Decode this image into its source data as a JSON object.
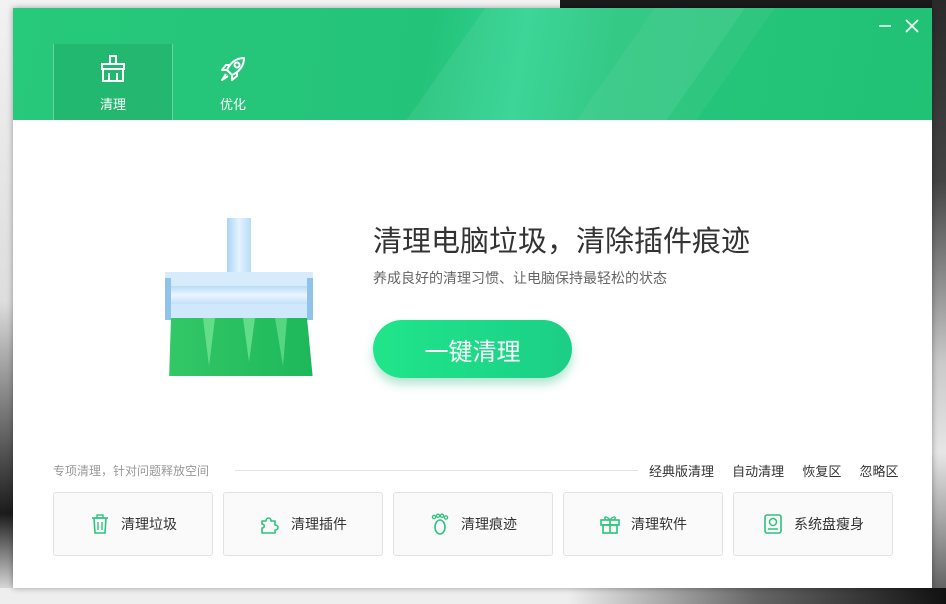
{
  "tabs": [
    {
      "label": "清理",
      "icon": "broom-icon",
      "active": true
    },
    {
      "label": "优化",
      "icon": "rocket-icon",
      "active": false
    }
  ],
  "window_controls": {
    "minimize": "minimize-icon",
    "close": "close-icon"
  },
  "hero": {
    "title": "清理电脑垃圾，清除插件痕迹",
    "subtitle": "养成良好的清理习惯、让电脑保持最轻松的状态",
    "button": "一键清理"
  },
  "section": {
    "label": "专项清理，针对问题释放空间",
    "links": [
      "经典版清理",
      "自动清理",
      "恢复区",
      "忽略区"
    ]
  },
  "cards": [
    {
      "label": "清理垃圾",
      "icon": "trash-icon"
    },
    {
      "label": "清理插件",
      "icon": "puzzle-icon"
    },
    {
      "label": "清理痕迹",
      "icon": "footprint-icon"
    },
    {
      "label": "清理软件",
      "icon": "gift-box-icon"
    },
    {
      "label": "系统盘瘦身",
      "icon": "disk-icon"
    }
  ],
  "colors": {
    "accent": "#22c275",
    "button": "#20e58a",
    "icon_green": "#2cc37d"
  }
}
